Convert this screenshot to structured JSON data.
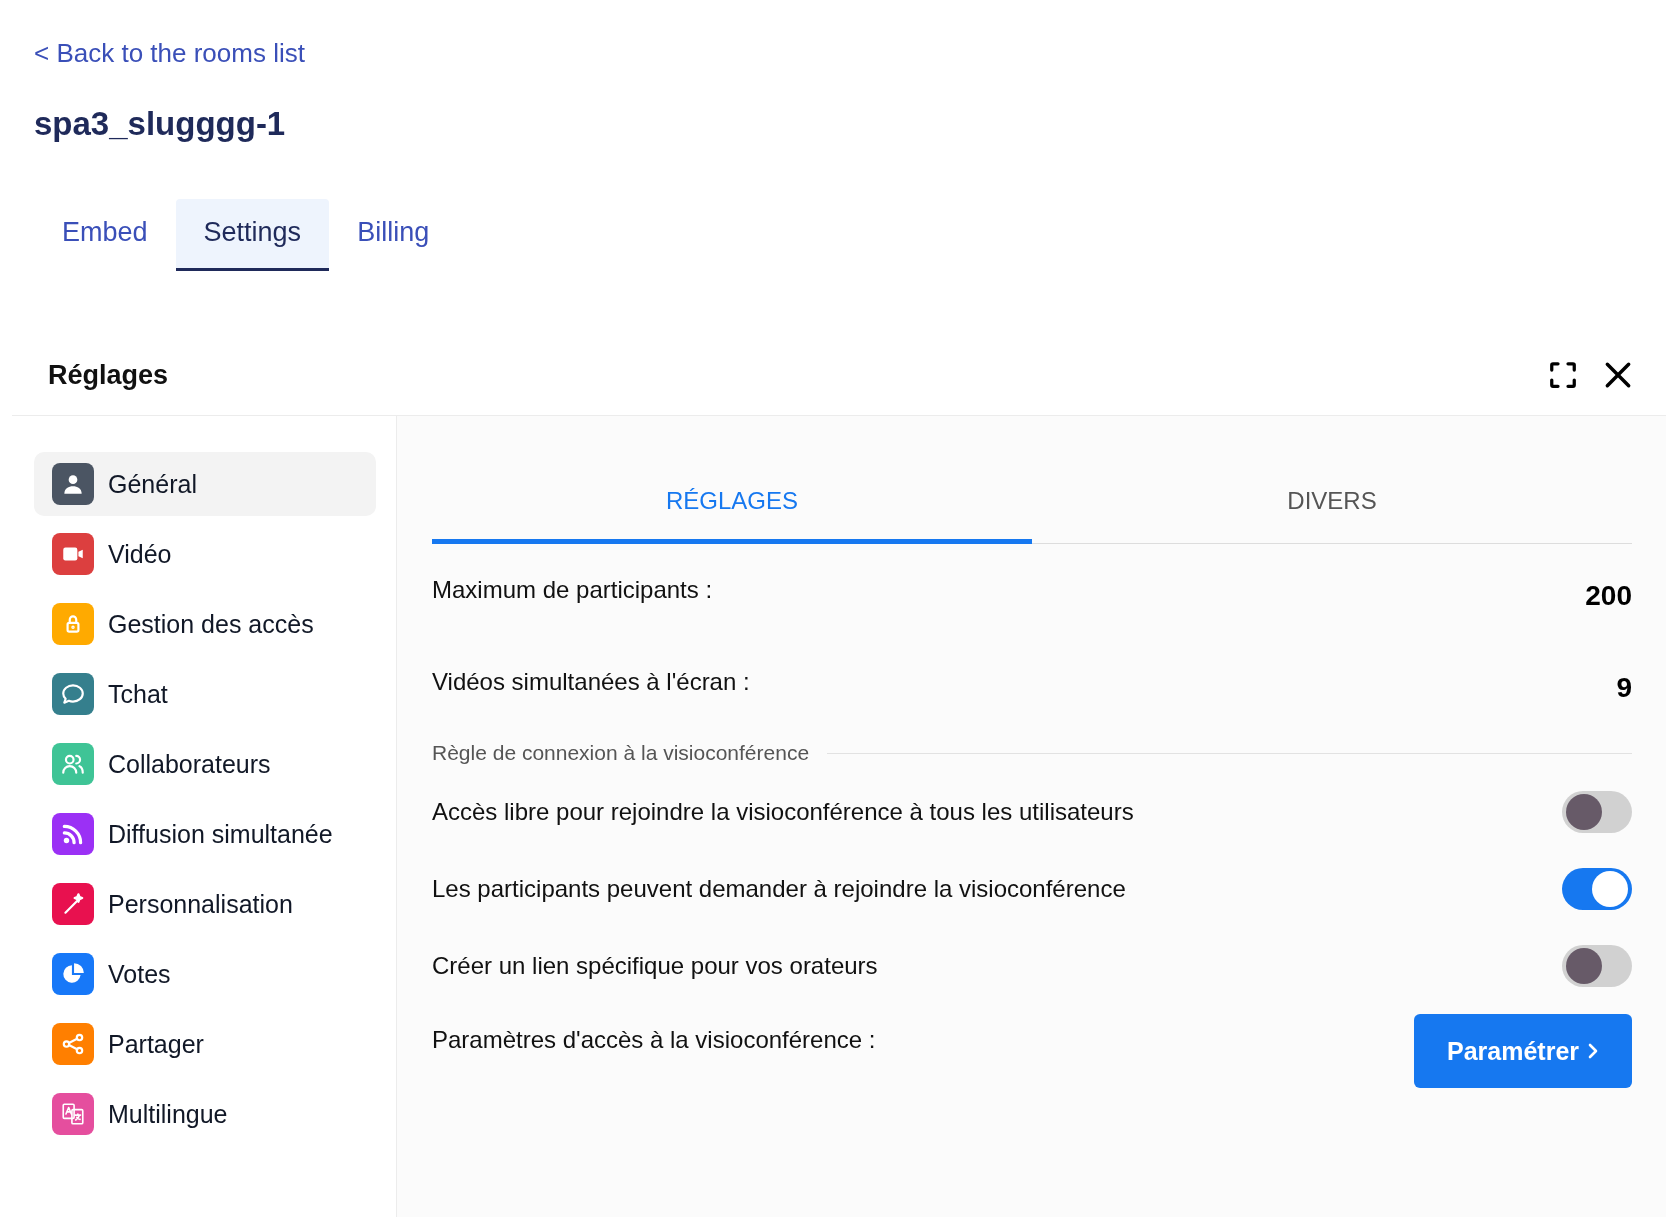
{
  "back_link": "< Back to the rooms list",
  "room_title": "spa3_slugggg-1",
  "tabs": [
    {
      "label": "Embed",
      "selected": false
    },
    {
      "label": "Settings",
      "selected": true
    },
    {
      "label": "Billing",
      "selected": false
    }
  ],
  "panel": {
    "title": "Réglages"
  },
  "sidebar": {
    "items": [
      {
        "label": "Général",
        "selected": true,
        "color": "#4b5563"
      },
      {
        "label": "Vidéo",
        "selected": false,
        "color": "#dc3f3f"
      },
      {
        "label": "Gestion des accès",
        "selected": false,
        "color": "#ffaa00"
      },
      {
        "label": "Tchat",
        "selected": false,
        "color": "#357f8d"
      },
      {
        "label": "Collaborateurs",
        "selected": false,
        "color": "#3fc496"
      },
      {
        "label": "Diffusion simultanée",
        "selected": false,
        "color": "#9b30f5"
      },
      {
        "label": "Personnalisation",
        "selected": false,
        "color": "#e8114f"
      },
      {
        "label": "Votes",
        "selected": false,
        "color": "#1778f8"
      },
      {
        "label": "Partager",
        "selected": false,
        "color": "#ff7f00"
      },
      {
        "label": "Multilingue",
        "selected": false,
        "color": "#e54e9e"
      }
    ]
  },
  "content_tabs": [
    {
      "label": "RÉGLAGES",
      "selected": true
    },
    {
      "label": "DIVERS",
      "selected": false
    }
  ],
  "fields": [
    {
      "label": "Maximum de participants :",
      "value": "200"
    },
    {
      "label": "Vidéos simultanées à l'écran :",
      "value": "9"
    }
  ],
  "section_title": "Règle de connexion à la visioconférence",
  "toggles": [
    {
      "label": "Accès libre pour rejoindre la visioconférence à tous les utilisateurs",
      "on": false
    },
    {
      "label": "Les participants peuvent demander à rejoindre la visioconférence",
      "on": true
    },
    {
      "label": "Créer un lien spécifique pour vos orateurs",
      "on": false
    }
  ],
  "access_settings": {
    "label": "Paramètres d'accès à la visioconférence :",
    "button": "Paramétrer"
  }
}
